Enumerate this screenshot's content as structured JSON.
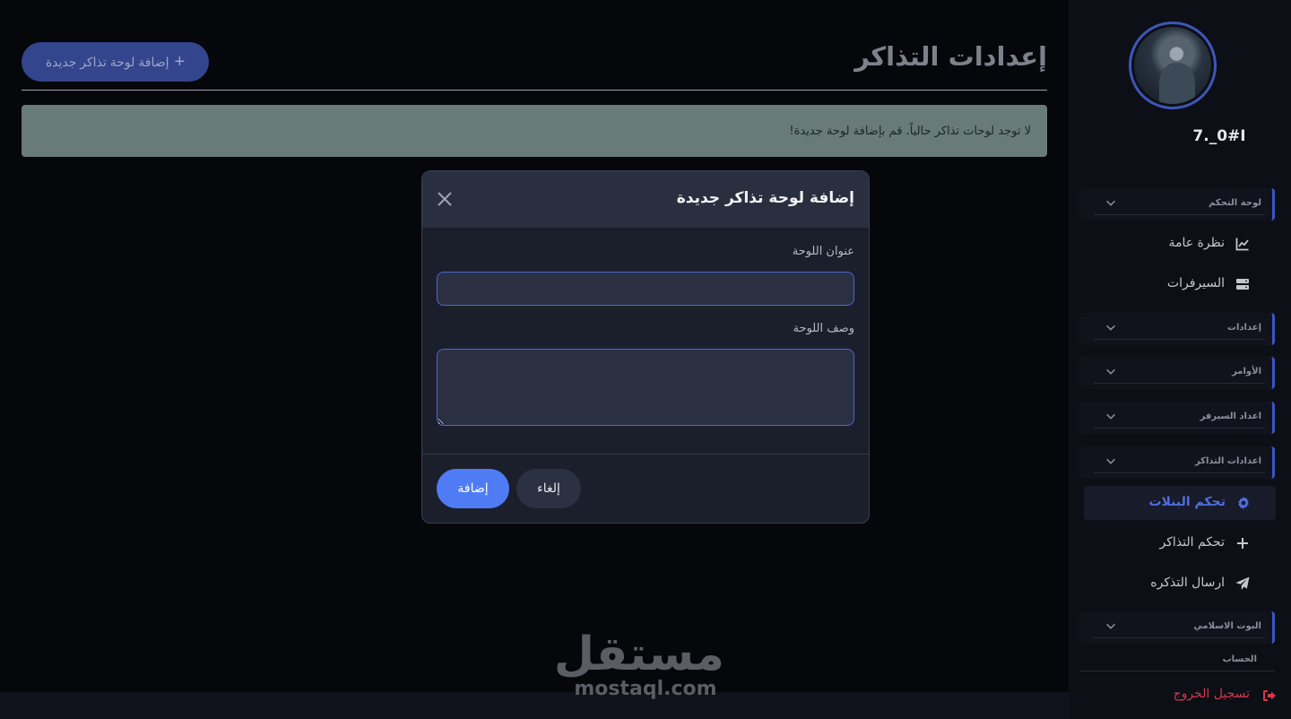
{
  "sidebar": {
    "username": "7._0#I",
    "groups": [
      {
        "label": "لوحة التحكم"
      },
      {
        "label": "إعدادات"
      },
      {
        "label": "الأوامر"
      },
      {
        "label": "اعداد السيرفر"
      },
      {
        "label": "اعدادات التذاكر"
      },
      {
        "label": "البوت الاسلامي"
      }
    ],
    "items": [
      {
        "label": "نظرة عامة",
        "icon": "chart-line-icon"
      },
      {
        "label": "السيرفرات",
        "icon": "server-icon"
      },
      {
        "label": "تحكم البنلات",
        "icon": "gear-icon"
      },
      {
        "label": "تحكم التذاكر",
        "icon": "plus-icon"
      },
      {
        "label": "ارسال التذكره",
        "icon": "paper-plane-icon"
      }
    ],
    "account_section": "الحساب",
    "logout": "تسجيل الخروج"
  },
  "main": {
    "title": "إعدادات التذاكر",
    "add_button": "إضافة لوحة تذاكر جديدة",
    "alert": "لا توجد لوحات تذاكر حالياً. قم بإضافة لوحة جديدة!"
  },
  "modal": {
    "title": "إضافة لوحة تذاكر جديدة",
    "field_title_label": "عنوان اللوحة",
    "field_title_value": "",
    "field_desc_label": "وصف اللوحة",
    "field_desc_value": "",
    "submit": "إضافة",
    "cancel": "إلغاء"
  },
  "watermark": {
    "logo": "مستقل",
    "url": "mostaql.com"
  },
  "colors": {
    "accent": "#4f7cf5",
    "active_nav": "#4f6fe0",
    "logout": "#d2374a",
    "alert_bg": "#697b78"
  }
}
